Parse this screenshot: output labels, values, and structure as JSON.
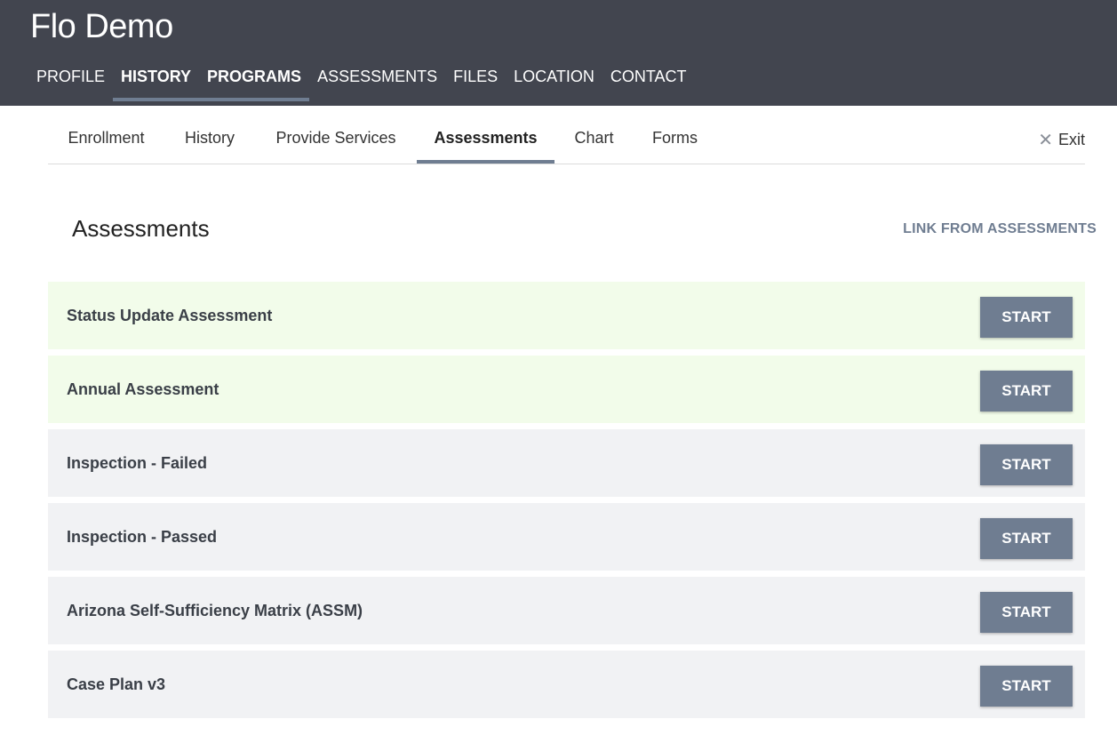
{
  "header": {
    "title": "Flo Demo",
    "nav": [
      {
        "label": "PROFILE",
        "active": false
      },
      {
        "label": "HISTORY",
        "active": true
      },
      {
        "label": "PROGRAMS",
        "active": true
      },
      {
        "label": "ASSESSMENTS",
        "active": false
      },
      {
        "label": "FILES",
        "active": false
      },
      {
        "label": "LOCATION",
        "active": false
      },
      {
        "label": "CONTACT",
        "active": false
      }
    ]
  },
  "subtabs": {
    "items": [
      {
        "label": "Enrollment"
      },
      {
        "label": "History"
      },
      {
        "label": "Provide Services"
      },
      {
        "label": "Assessments"
      },
      {
        "label": "Chart"
      },
      {
        "label": "Forms"
      }
    ],
    "exit_label": "Exit",
    "exit_icon": "close-icon"
  },
  "section": {
    "title": "Assessments",
    "link_label": "LINK FROM ASSESSMENTS"
  },
  "assessments": [
    {
      "name": "Status Update Assessment",
      "button": "START"
    },
    {
      "name": "Annual Assessment",
      "button": "START"
    },
    {
      "name": "Inspection - Failed",
      "button": "START"
    },
    {
      "name": "Inspection - Passed",
      "button": "START"
    },
    {
      "name": "Arizona Self-Sufficiency Matrix (ASSM)",
      "button": "START"
    },
    {
      "name": "Case Plan v3",
      "button": "START"
    }
  ],
  "colors": {
    "header_bg": "#42454f",
    "accent": "#6f7d91",
    "row_highlight": "#f2fcea",
    "row_default": "#f1f2f4"
  }
}
